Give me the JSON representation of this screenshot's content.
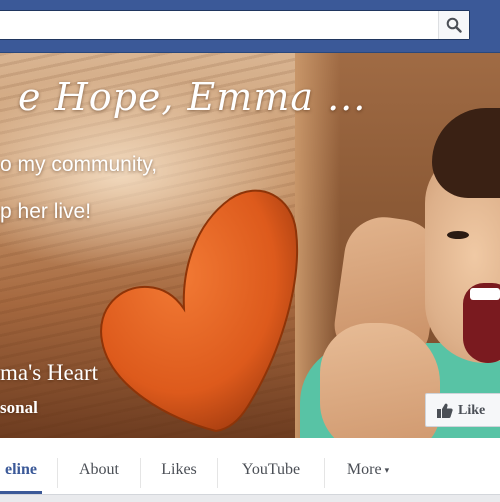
{
  "search": {
    "placeholder": ""
  },
  "cover": {
    "headline": "e Hope, Emma ...",
    "line1": "o my community,",
    "line2": "p her live!",
    "page_name": "ma's Heart",
    "page_category": "sonal"
  },
  "like_button": {
    "label": "Like",
    "icon": "thumbs-up-icon"
  },
  "nav": {
    "tabs": [
      {
        "label": "eline",
        "active": true
      },
      {
        "label": "About"
      },
      {
        "label": "Likes"
      },
      {
        "label": "YouTube"
      },
      {
        "label": "More",
        "caret": "▾"
      }
    ]
  },
  "colors": {
    "brand_blue": "#3b5998",
    "heart": "#e5621f",
    "shirt": "#58c3a5"
  }
}
